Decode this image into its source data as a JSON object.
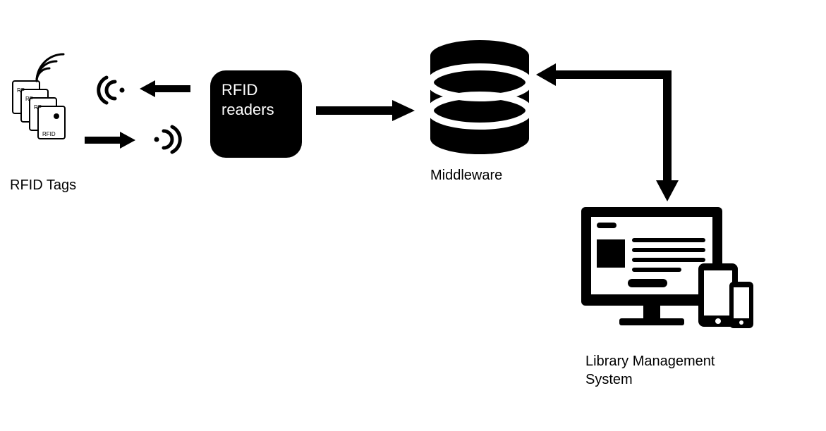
{
  "nodes": {
    "rfid_tags": {
      "label": "RFID Tags"
    },
    "rfid_readers": {
      "label": "RFID\nreaders"
    },
    "middleware": {
      "label": "Middleware"
    },
    "lms": {
      "label": "Library Management\nSystem"
    }
  }
}
